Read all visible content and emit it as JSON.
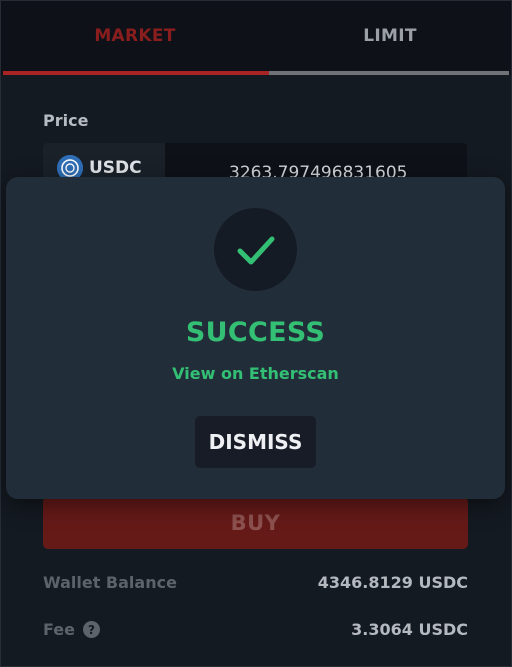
{
  "tabs": [
    {
      "label": "MARKET",
      "active": true
    },
    {
      "label": "LIMIT",
      "active": false
    }
  ],
  "price": {
    "label": "Price",
    "token": "USDC",
    "value": "3263.797496831605"
  },
  "buy_button": {
    "label": "BUY"
  },
  "wallet_balance": {
    "label": "Wallet Balance",
    "value": "4346.8129 USDC"
  },
  "fee": {
    "label": "Fee",
    "help_icon": "?",
    "value": "3.3064 USDC"
  },
  "modal": {
    "icon": "check-icon",
    "title": "SUCCESS",
    "link": "View on Etherscan",
    "dismiss_label": "DISMISS"
  },
  "colors": {
    "accent_red": "#a82424",
    "buy_bg": "#661a18",
    "success_green": "#33c074",
    "modal_bg": "#222d3a"
  }
}
